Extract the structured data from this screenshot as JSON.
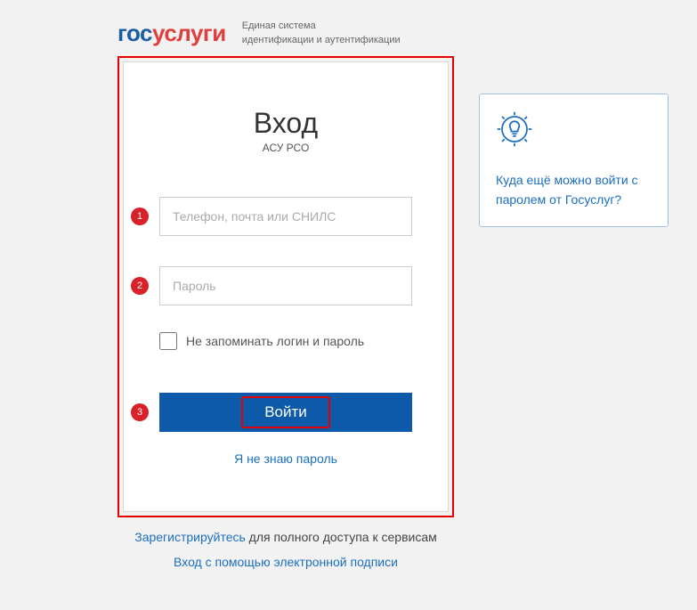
{
  "header": {
    "logo_part1": "гос",
    "logo_part2": "услуги",
    "tagline_line1": "Единая система",
    "tagline_line2": "идентификации и аутентификации"
  },
  "login": {
    "title": "Вход",
    "subtitle": "АСУ РСО",
    "login_placeholder": "Телефон, почта или СНИЛС",
    "password_placeholder": "Пароль",
    "remember_label": "Не запоминать логин и пароль",
    "submit_label": "Войти",
    "forgot_label": "Я не знаю пароль"
  },
  "markers": {
    "m1": "1",
    "m2": "2",
    "m3": "3"
  },
  "footer": {
    "register_link": "Зарегистрируйтесь",
    "register_rest": " для полного доступа к сервисам",
    "esign": "Вход с помощью электронной подписи"
  },
  "side": {
    "link_text": "Куда ещё можно войти с паролем от Госуслуг?"
  }
}
